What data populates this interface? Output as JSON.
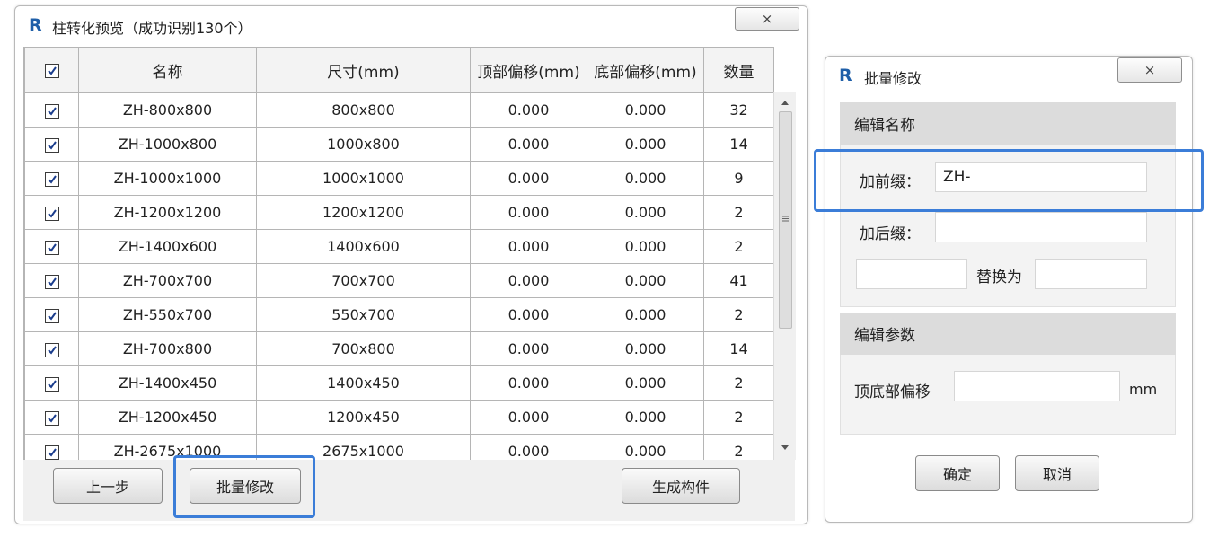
{
  "main_window": {
    "logo": "R",
    "title": "柱转化预览（成功识别130个）",
    "close_glyph": "×",
    "columns": [
      "名称",
      "尺寸(mm)",
      "顶部偏移(mm)",
      "底部偏移(mm)",
      "数量"
    ],
    "rows": [
      {
        "name": "ZH-800x800",
        "size": "800x800",
        "top": "0.000",
        "bottom": "0.000",
        "count": "32"
      },
      {
        "name": "ZH-1000x800",
        "size": "1000x800",
        "top": "0.000",
        "bottom": "0.000",
        "count": "14"
      },
      {
        "name": "ZH-1000x1000",
        "size": "1000x1000",
        "top": "0.000",
        "bottom": "0.000",
        "count": "9"
      },
      {
        "name": "ZH-1200x1200",
        "size": "1200x1200",
        "top": "0.000",
        "bottom": "0.000",
        "count": "2"
      },
      {
        "name": "ZH-1400x600",
        "size": "1400x600",
        "top": "0.000",
        "bottom": "0.000",
        "count": "2"
      },
      {
        "name": "ZH-700x700",
        "size": "700x700",
        "top": "0.000",
        "bottom": "0.000",
        "count": "41"
      },
      {
        "name": "ZH-550x700",
        "size": "550x700",
        "top": "0.000",
        "bottom": "0.000",
        "count": "2"
      },
      {
        "name": "ZH-700x800",
        "size": "700x800",
        "top": "0.000",
        "bottom": "0.000",
        "count": "14"
      },
      {
        "name": "ZH-1400x450",
        "size": "1400x450",
        "top": "0.000",
        "bottom": "0.000",
        "count": "2"
      },
      {
        "name": "ZH-1200x450",
        "size": "1200x450",
        "top": "0.000",
        "bottom": "0.000",
        "count": "2"
      },
      {
        "name": "ZH-2675x1000",
        "size": "2675x1000",
        "top": "0.000",
        "bottom": "0.000",
        "count": "2"
      }
    ],
    "buttons": {
      "prev": "上一步",
      "batch_edit": "批量修改",
      "generate": "生成构件"
    }
  },
  "batch_dialog": {
    "logo": "R",
    "title": "批量修改",
    "close_glyph": "×",
    "edit_name": {
      "header": "编辑名称",
      "prefix_label": "加前缀：",
      "prefix_value": "ZH-",
      "suffix_label": "加后缀：",
      "suffix_value": "",
      "find_value": "",
      "replace_label": "替换为",
      "replace_value": ""
    },
    "edit_params": {
      "header": "编辑参数",
      "offset_label": "顶底部偏移",
      "offset_value": "",
      "unit": "mm"
    },
    "buttons": {
      "ok": "确定",
      "cancel": "取消"
    }
  },
  "colors": {
    "highlight": "#3b7dd8",
    "logo": "#1f5fa8"
  }
}
